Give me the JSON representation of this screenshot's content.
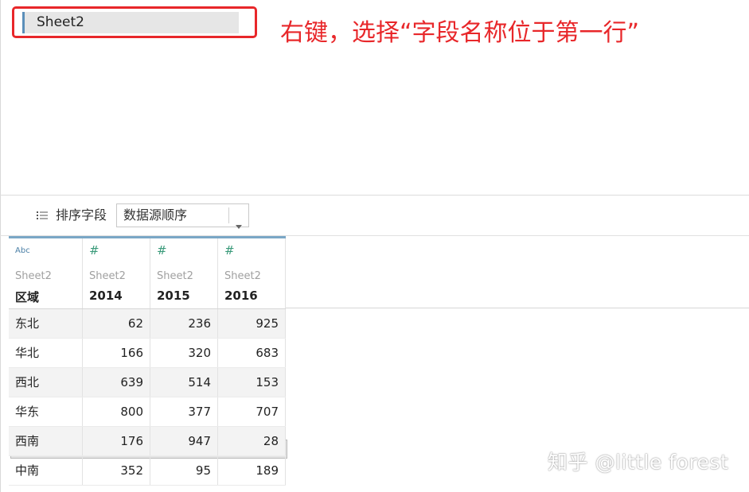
{
  "sheet": {
    "name": "Sheet2"
  },
  "annotation": "右键，选择“字段名称位于第一行”",
  "toolbar": {
    "sort_label": "排序字段",
    "sort_value": "数据源顺序"
  },
  "grid": {
    "columns": [
      {
        "type": "Abc",
        "source": "Sheet2",
        "field": "区域"
      },
      {
        "type": "#",
        "source": "Sheet2",
        "field": "2014"
      },
      {
        "type": "#",
        "source": "Sheet2",
        "field": "2015"
      },
      {
        "type": "#",
        "source": "Sheet2",
        "field": "2016"
      }
    ],
    "rows": [
      [
        "东北",
        "62",
        "236",
        "925"
      ],
      [
        "华北",
        "166",
        "320",
        "683"
      ],
      [
        "西北",
        "639",
        "514",
        "153"
      ],
      [
        "华东",
        "800",
        "377",
        "707"
      ],
      [
        "西南",
        "176",
        "947",
        "28"
      ],
      [
        "中南",
        "352",
        "95",
        "189"
      ]
    ]
  },
  "watermark": "知乎 @little forest",
  "colors": {
    "highlight": "#e8272a",
    "accent": "#7aa7c6"
  },
  "icons": {
    "grid_view": "grid-view-icon",
    "list_view": "list-view-icon",
    "dropdown": "chevron-down-icon"
  }
}
